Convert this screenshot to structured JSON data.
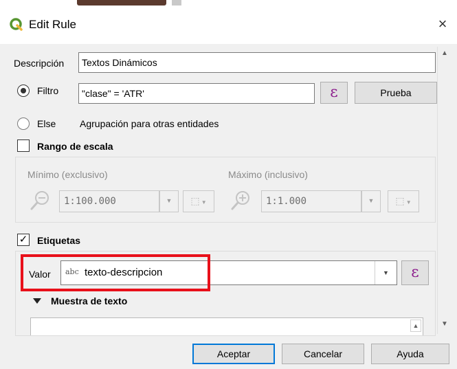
{
  "window": {
    "title": "Edit Rule",
    "close_glyph": "×"
  },
  "descripcion": {
    "label": "Descripción",
    "value": "Textos Dinámicos"
  },
  "filtro": {
    "label": "Filtro",
    "value": "\"clase\"  =  'ATR'",
    "expression_glyph": "ε",
    "test_button": "Prueba"
  },
  "else": {
    "label": "Else",
    "description": "Agrupación para otras entidades"
  },
  "rango_escala": {
    "label": "Rango de escala",
    "checked": false,
    "minimo_label": "Mínimo (exclusivo)",
    "minimo_value": "1:100.000",
    "maximo_label": "Máximo (inclusivo)",
    "maximo_value": "1:1.000"
  },
  "etiquetas": {
    "label": "Etiquetas",
    "checked": true,
    "check_glyph": "✓",
    "valor_label": "Valor",
    "valor_prefix": "abc",
    "valor_value": "texto-descripcion",
    "expression_glyph": "ε",
    "muestra_label": "Muestra de texto"
  },
  "buttons": {
    "aceptar": "Aceptar",
    "cancelar": "Cancelar",
    "ayuda": "Ayuda"
  },
  "colors": {
    "highlight": "#e8101a",
    "qgis_green": "#589632",
    "expression_purple": "#8b1a8b",
    "dialog_bg": "#f0f0f0"
  },
  "icons": {
    "logo": "qgis-logo-icon",
    "close": "close-icon",
    "zoom_out": "zoom-out-icon",
    "zoom_in": "zoom-in-icon",
    "map_canvas": "map-canvas-scale-icon"
  }
}
